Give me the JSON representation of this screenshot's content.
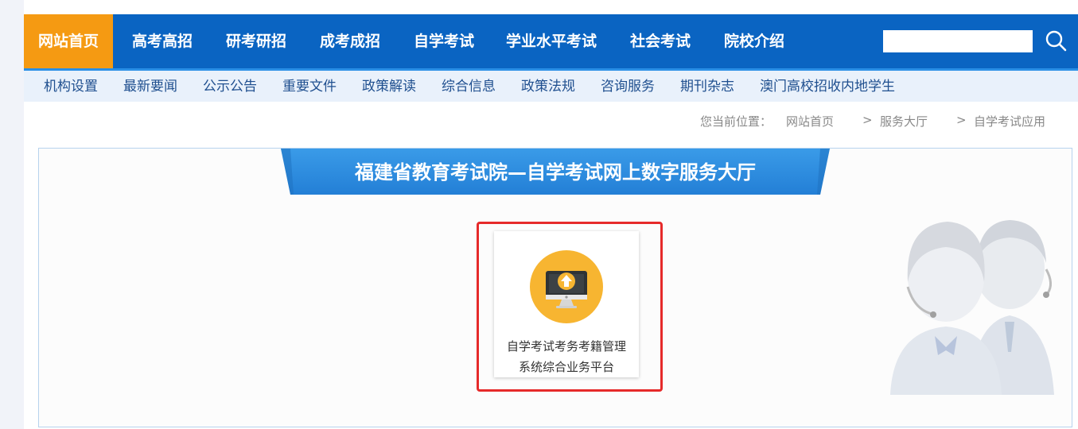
{
  "top_nav": {
    "items": [
      {
        "label": "网站首页",
        "active": true
      },
      {
        "label": "高考高招"
      },
      {
        "label": "研考研招"
      },
      {
        "label": "成考成招"
      },
      {
        "label": "自学考试"
      },
      {
        "label": "学业水平考试"
      },
      {
        "label": "社会考试"
      },
      {
        "label": "院校介绍"
      }
    ],
    "search": {
      "placeholder": "",
      "value": ""
    },
    "search_icon": "search-icon"
  },
  "sub_nav": {
    "items": [
      {
        "label": "机构设置"
      },
      {
        "label": "最新要闻"
      },
      {
        "label": "公示公告"
      },
      {
        "label": "重要文件"
      },
      {
        "label": "政策解读"
      },
      {
        "label": "综合信息"
      },
      {
        "label": "政策法规"
      },
      {
        "label": "咨询服务"
      },
      {
        "label": "期刊杂志"
      },
      {
        "label": "澳门高校招收内地学生"
      }
    ]
  },
  "breadcrumb": {
    "prefix": "您当前位置：",
    "items": [
      "网站首页",
      "服务大厅",
      "自学考试应用"
    ],
    "separator": ">"
  },
  "panel": {
    "banner_title": "福建省教育考试院—自学考试网上数字服务大厅",
    "tiles": [
      {
        "icon": "computer-upload-icon",
        "line1": "自学考试考务考籍管理",
        "line2": "系统综合业务平台"
      }
    ],
    "decoration_icon": "customer-service-agents-icon"
  },
  "colors": {
    "nav_bg": "#0a64c2",
    "nav_active": "#f59a12",
    "subnav_bg": "#e9f1fb",
    "banner": "#2c8de0",
    "highlight": "#e62a2a",
    "tile_icon": "#f7b531"
  }
}
